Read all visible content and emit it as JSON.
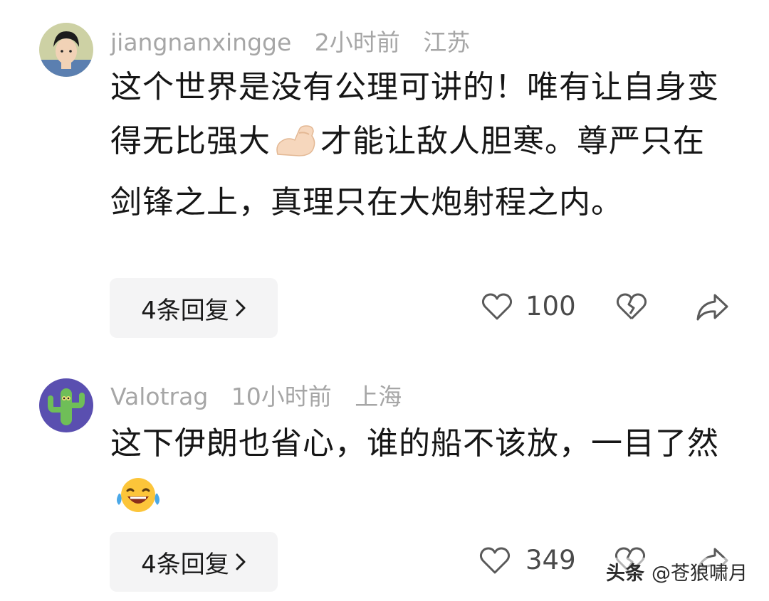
{
  "comments": [
    {
      "username": "jiangnanxingge",
      "time": "2小时前",
      "location": "江苏",
      "text_parts": [
        "这个世界是没有公理可讲的！唯有让自身变得无比强大",
        "才能让敌人胆寒。尊严只在剑锋之上，真理只在大炮射程之内。"
      ],
      "emoji": "flexed-biceps-emoji",
      "reply_label": "4条回复",
      "like_count": "100"
    },
    {
      "username": "Valotrag",
      "time": "10小时前",
      "location": "上海",
      "text_parts": [
        "这下伊朗也省心，谁的船不该放，一目了然"
      ],
      "emoji": "tears-of-joy-emoji",
      "reply_label": "4条回复",
      "like_count": "349"
    }
  ],
  "watermark": {
    "brand": "头条",
    "handle": "@苍狼啸月"
  },
  "colors": {
    "meta_gray": "#a6a6a6",
    "text": "#161616",
    "button_bg": "#f4f4f5",
    "icon_gray": "#5a5a5a"
  }
}
